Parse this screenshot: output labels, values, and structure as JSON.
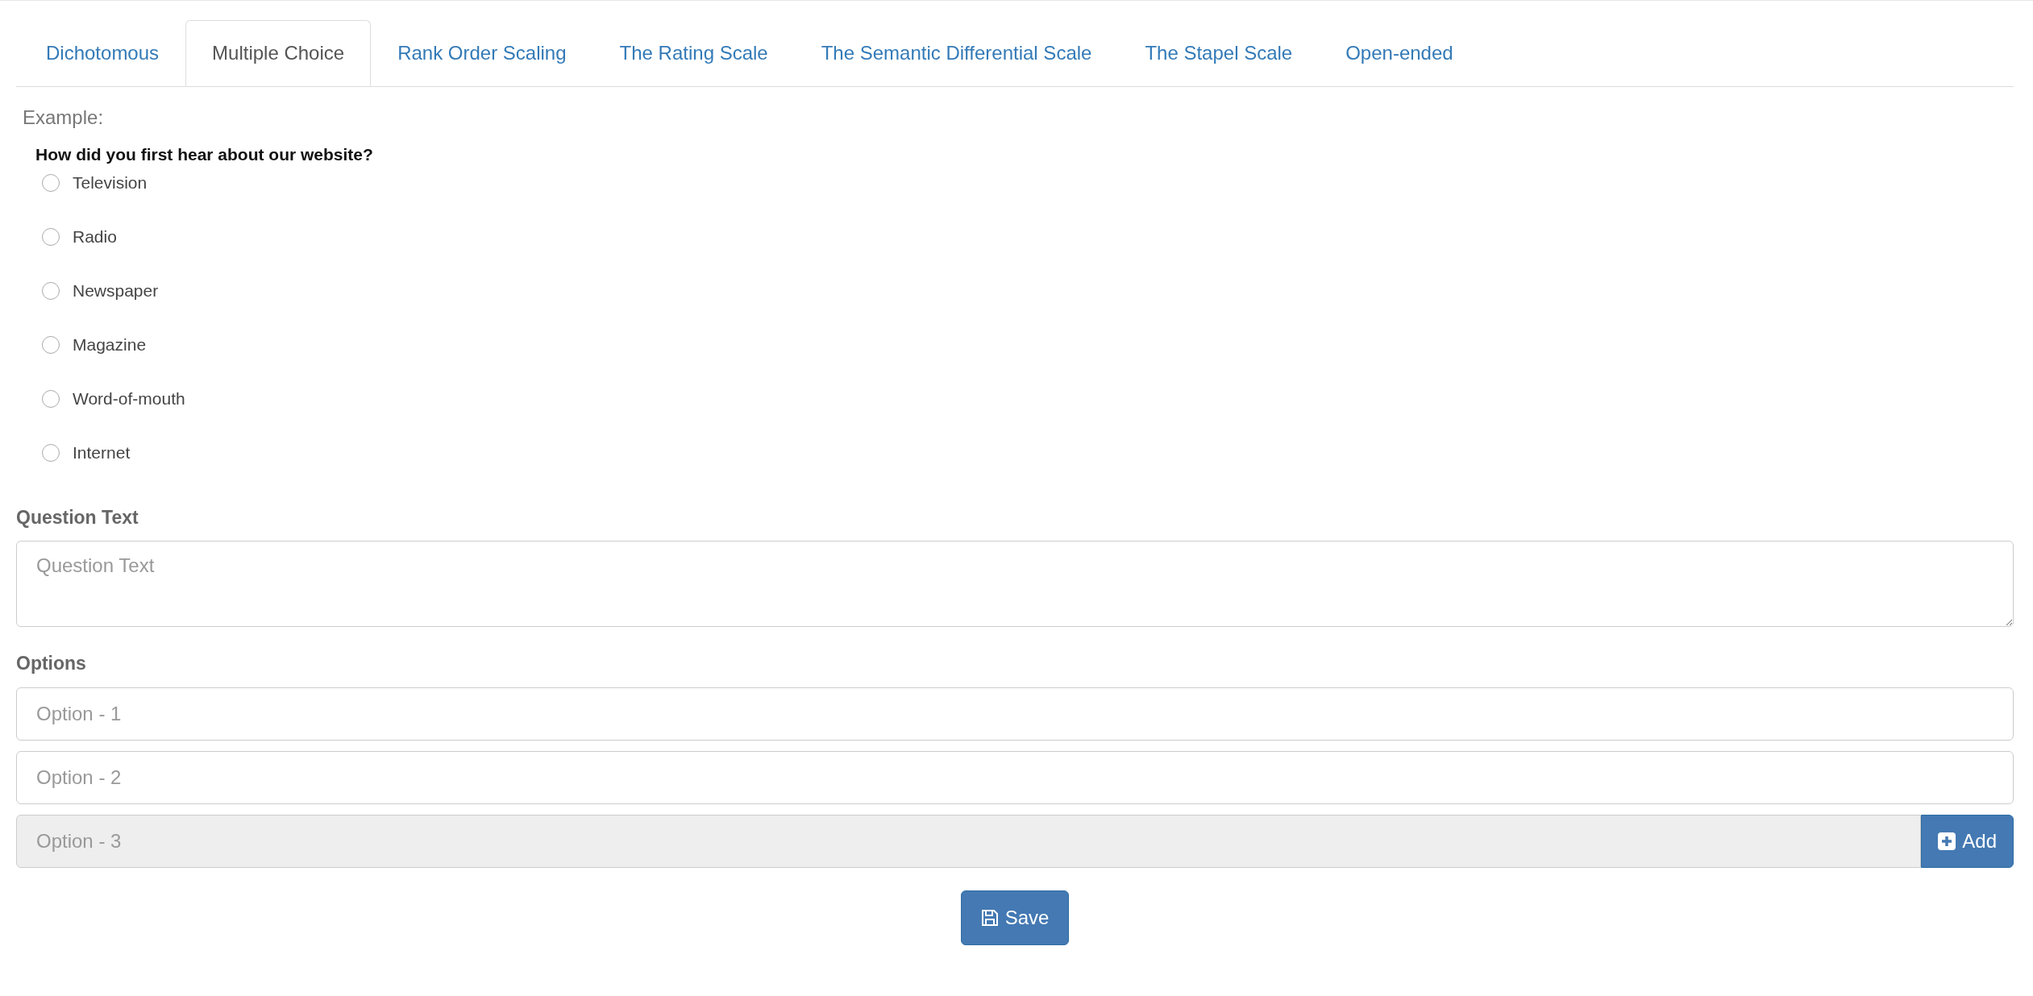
{
  "tabs": [
    {
      "label": "Dichotomous",
      "selected": false
    },
    {
      "label": "Multiple Choice",
      "selected": true
    },
    {
      "label": "Rank Order Scaling",
      "selected": false
    },
    {
      "label": "The Rating Scale",
      "selected": false
    },
    {
      "label": "The Semantic Differential Scale",
      "selected": false
    },
    {
      "label": "The Stapel Scale",
      "selected": false
    },
    {
      "label": "Open-ended",
      "selected": false
    }
  ],
  "example": {
    "heading": "Example:",
    "question": "How did you first hear about our website?",
    "choices": [
      {
        "label": "Television",
        "selected": false
      },
      {
        "label": "Radio",
        "selected": false
      },
      {
        "label": "Newspaper",
        "selected": false
      },
      {
        "label": "Magazine",
        "selected": false
      },
      {
        "label": "Word-of-mouth",
        "selected": false
      },
      {
        "label": "Internet",
        "selected": false
      }
    ]
  },
  "question_text": {
    "label": "Question Text",
    "placeholder": "Question Text"
  },
  "options": {
    "label": "Options",
    "fields": [
      {
        "placeholder": "Option - 1",
        "disabled": false
      },
      {
        "placeholder": "Option - 2",
        "disabled": false
      },
      {
        "placeholder": "Option - 3",
        "disabled": true
      }
    ],
    "add_button": "Add"
  },
  "save_button": "Save"
}
